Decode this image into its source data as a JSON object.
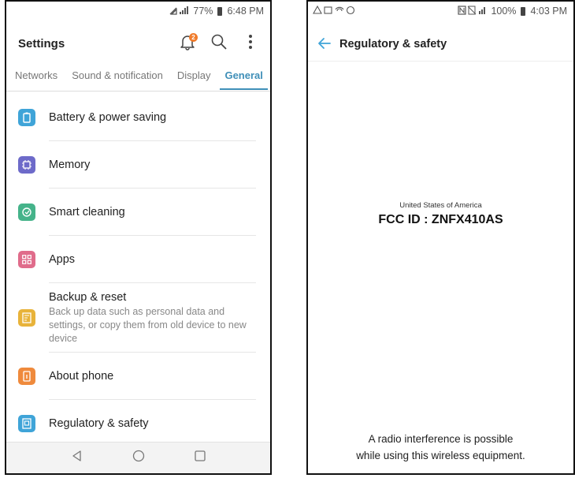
{
  "left": {
    "status": {
      "signal_icons": "⭘…☰",
      "battery": "77%",
      "time": "6:48 PM"
    },
    "appbar": {
      "title": "Settings",
      "notification_count": "2",
      "icons": [
        "bell-icon",
        "search-icon",
        "more-vert-icon"
      ]
    },
    "tabs": [
      {
        "label": "Networks",
        "active": false
      },
      {
        "label": "Sound & notification",
        "active": false
      },
      {
        "label": "Display",
        "active": false
      },
      {
        "label": "General",
        "active": true
      }
    ],
    "items": [
      {
        "label": "Battery & power saving",
        "description": "",
        "icon": "battery-icon",
        "color": "#3fa4d8"
      },
      {
        "label": "Memory",
        "description": "",
        "icon": "memory-chip-icon",
        "color": "#6d6ac9"
      },
      {
        "label": "Smart cleaning",
        "description": "",
        "icon": "smart-cleaning-icon",
        "color": "#45b38a"
      },
      {
        "label": "Apps",
        "description": "",
        "icon": "apps-grid-icon",
        "color": "#e06c8b"
      },
      {
        "label": "Backup & reset",
        "description": "Back up data such as personal data and settings, or copy them from old device to new device",
        "icon": "backup-icon",
        "color": "#e8b33a"
      },
      {
        "label": "About phone",
        "description": "",
        "icon": "about-phone-icon",
        "color": "#ef8a3c"
      },
      {
        "label": "Regulatory & safety",
        "description": "",
        "icon": "regulatory-icon",
        "color": "#3fa4d8"
      }
    ],
    "navbar": [
      "back-nav-icon",
      "home-nav-icon",
      "recents-nav-icon"
    ]
  },
  "right": {
    "status": {
      "left_icons": "⚠ ✉ ≈ ⚙",
      "battery": "100%",
      "time": "4:03 PM"
    },
    "appbar": {
      "title": "Regulatory & safety"
    },
    "country": "United States of America",
    "fcc_id": "FCC ID : ZNFX410AS",
    "notice_line1": "A radio interference is possible",
    "notice_line2": "while using this wireless equipment."
  },
  "colors": {
    "accent": "#3f8fb8",
    "badge": "#f07b2b",
    "back_arrow": "#3fa4d8"
  }
}
